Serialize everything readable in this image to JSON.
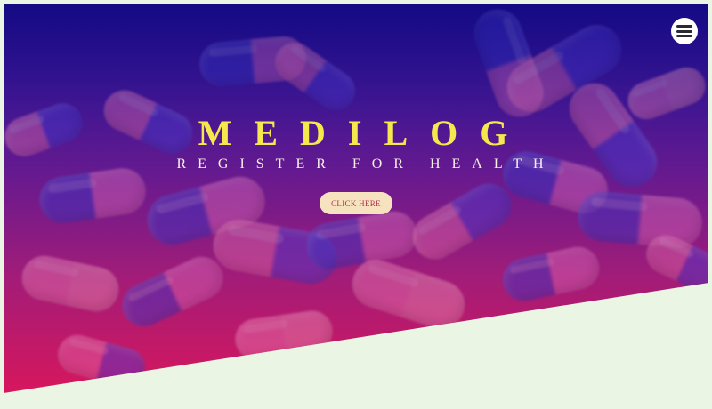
{
  "brand": {
    "title": "MEDILOG",
    "tagline": "REGISTER FOR HEALTH"
  },
  "cta": {
    "label": "CLICK HERE"
  },
  "header": {
    "menu_icon": "hamburger-menu-icon"
  },
  "colors": {
    "title": "#f4e84d",
    "tagline": "#f7f1e6",
    "cta_background": "#f6e2bf",
    "cta_text": "#b3304d",
    "gradient_top": "#140a84",
    "gradient_bottom": "#d8165c",
    "page_background": "#ebf5e3"
  }
}
